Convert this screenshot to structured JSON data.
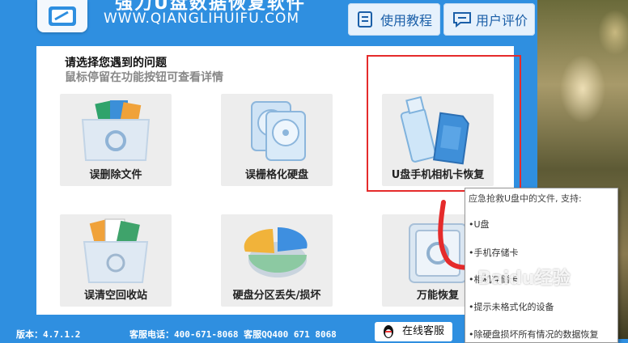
{
  "app": {
    "title": "强力U盘数据恢复软件",
    "url": "WWW.QIANGLIHUIFU.COM"
  },
  "toolbar": {
    "tutorial_label": "使用教程",
    "review_label": "用户评价"
  },
  "panel": {
    "heading": "请选择您遇到的问题",
    "subheading": "鼠标停留在功能按钮可查看详情",
    "tiles": [
      {
        "label": "误删除文件",
        "icon": "deleted-files-icon"
      },
      {
        "label": "误栅格化硬盘",
        "icon": "formatted-disk-icon"
      },
      {
        "label": "U盘手机相机卡恢复",
        "icon": "usb-sdcard-icon"
      },
      {
        "label": "误清空回收站",
        "icon": "recycle-bin-icon"
      },
      {
        "label": "硬盘分区丢失/损坏",
        "icon": "partition-pie-icon"
      },
      {
        "label": "万能恢复",
        "icon": "safe-box-icon"
      }
    ]
  },
  "status": {
    "version": "版本：4.7.1.2",
    "phone": "客服电话：400-671-8068 客服QQ400 671 8068"
  },
  "service_button": {
    "label": "在线客服",
    "icon": "qq-penguin-icon"
  },
  "tooltip": {
    "title": "应急抢救U盘中的文件, 支持:",
    "items": [
      "•U盘",
      "•手机存储卡",
      "•相机存储卡",
      "•提示未格式化的设备",
      "•除硬盘损坏所有情况的数据恢复"
    ]
  },
  "watermark": "Baidu经验",
  "colors": {
    "accent": "#2f8fe0",
    "highlight": "#e52b2b",
    "button_bg": "#e6f1fc"
  }
}
